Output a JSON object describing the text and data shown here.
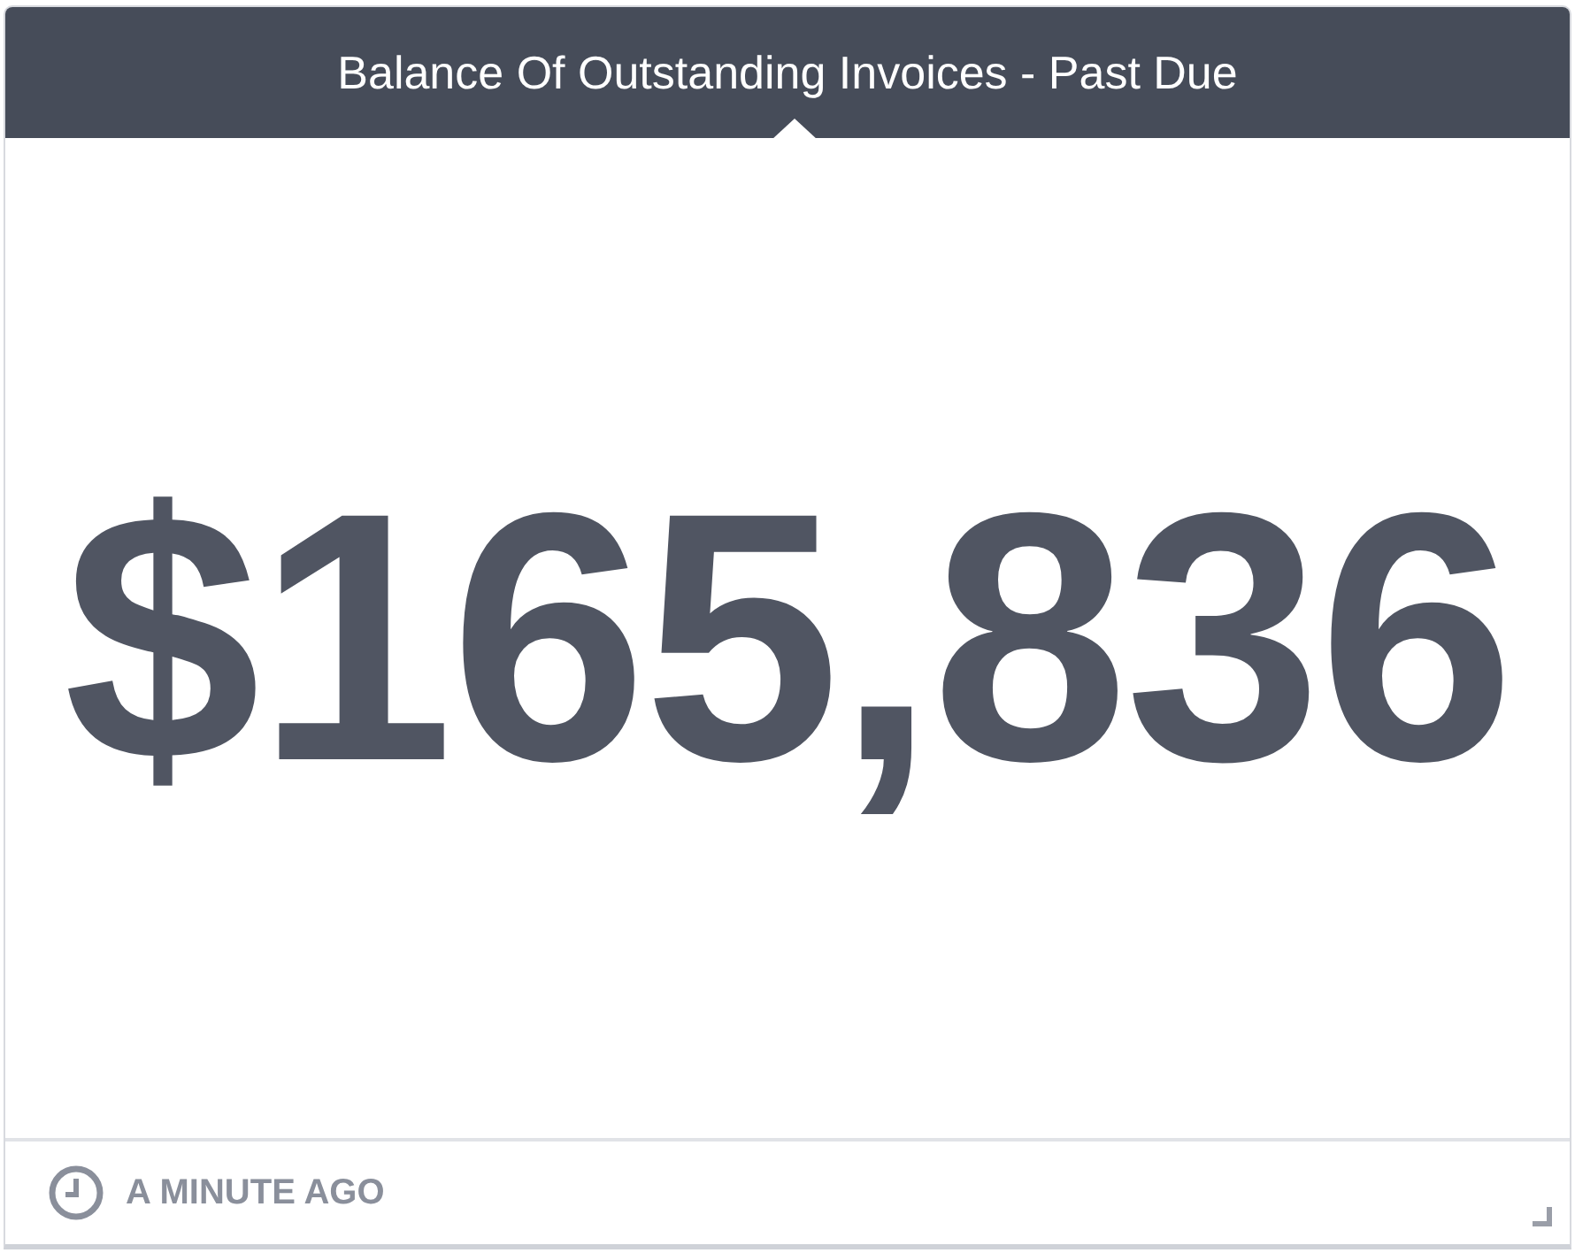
{
  "widget": {
    "title": "Balance Of Outstanding Invoices - Past Due",
    "value": "$165,836",
    "updated": "A MINUTE AGO"
  }
}
